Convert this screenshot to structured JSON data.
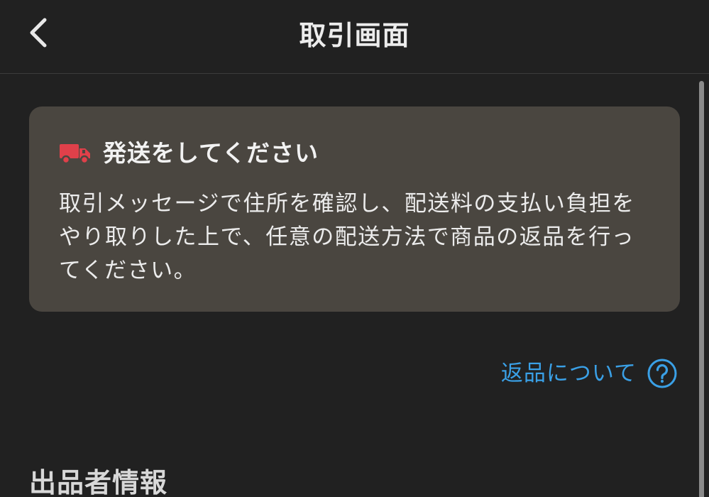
{
  "header": {
    "title": "取引画面",
    "back_icon": "chevron-left-icon"
  },
  "notice": {
    "icon": "truck-icon",
    "title": "発送をしてください",
    "body": "取引メッセージで住所を確認し、配送料の支払い負担を\nやり取りした上で、任意の配送方法で商品の返品を行っ\nてください。"
  },
  "return_link": {
    "label": "返品について",
    "icon": "help-circle-icon"
  },
  "seller_section": {
    "title": "出品者情報"
  },
  "colors": {
    "background": "#212121",
    "card": "#4a4640",
    "accent": "#3aa0e6",
    "truck": "#e0404a"
  }
}
